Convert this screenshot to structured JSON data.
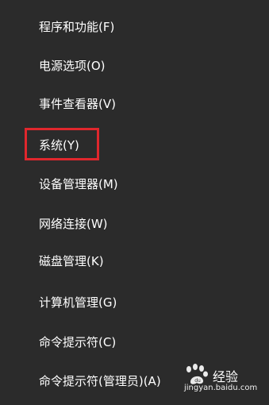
{
  "menu": {
    "items": [
      {
        "label": "程序和功能(F)"
      },
      {
        "label": "电源选项(O)"
      },
      {
        "label": "事件查看器(V)"
      },
      {
        "label": "系统(Y)"
      },
      {
        "label": "设备管理器(M)"
      },
      {
        "label": "网络连接(W)"
      },
      {
        "label": "磁盘管理(K)"
      },
      {
        "label": "计算机管理(G)"
      },
      {
        "label": "命令提示符(C)"
      },
      {
        "label": "命令提示符(管理员)(A)"
      }
    ],
    "highlighted_item": "系统(Y)",
    "highlight_color": "#e0272d",
    "background_color": "#2b2b2b",
    "text_color": "#ffffff"
  },
  "watermark": {
    "brand": "Baidu 经验",
    "title": "经验",
    "url": "jingyan.baidu.com",
    "logo_icon": "baidu-paw-icon"
  }
}
